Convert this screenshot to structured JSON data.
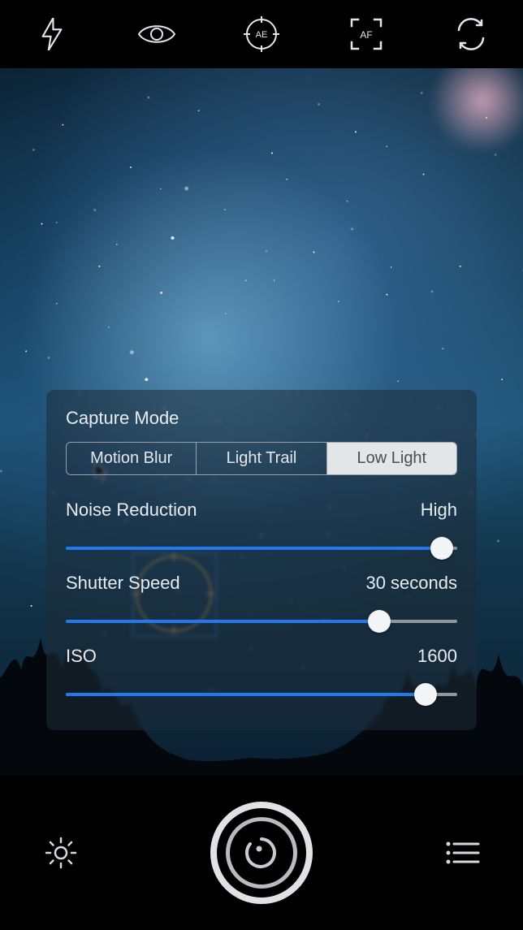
{
  "toolbar": {
    "flash": "flash-icon",
    "eye": "eye-icon",
    "ae": "ae-reticle-icon",
    "ae_label": "AE",
    "af": "af-frame-icon",
    "af_label": "AF",
    "swap": "swap-camera-icon"
  },
  "panel": {
    "title": "Capture Mode",
    "segments": [
      {
        "label": "Motion Blur",
        "selected": false
      },
      {
        "label": "Light Trail",
        "selected": false
      },
      {
        "label": "Low Light",
        "selected": true
      }
    ],
    "rows": [
      {
        "name": "Noise Reduction",
        "value": "High",
        "pct": 96
      },
      {
        "name": "Shutter Speed",
        "value": "30 seconds",
        "pct": 80
      },
      {
        "name": "ISO",
        "value": "1600",
        "pct": 92
      }
    ]
  },
  "bottom": {
    "settings": "gear-icon",
    "shutter": "timer-shutter-icon",
    "list": "list-icon"
  }
}
